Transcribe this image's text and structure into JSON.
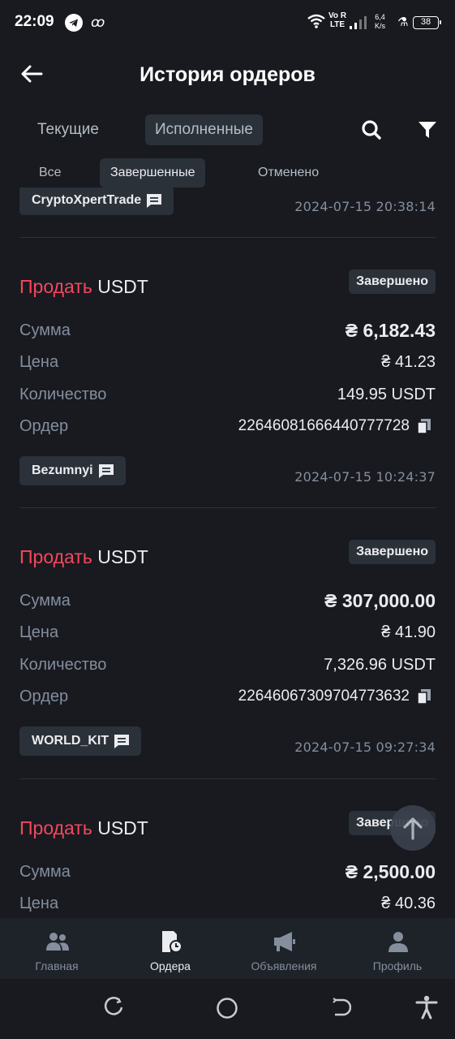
{
  "status_bar": {
    "time": "22:09",
    "volte_top": "Vo R",
    "volte_bottom": "LTE",
    "speed_top": "6,4",
    "speed_bottom": "K/s",
    "battery": "38",
    "misc_glyph": "ꝏ",
    "icons": [
      "telegram-icon",
      "wifi-icon",
      "signal-icon",
      "flask-icon",
      "battery-icon"
    ]
  },
  "header": {
    "title": "История ордеров"
  },
  "tabs": [
    {
      "label": "Текущие",
      "active": false
    },
    {
      "label": "Исполненные",
      "active": true
    }
  ],
  "subtabs": [
    {
      "label": "Все",
      "active": false
    },
    {
      "label": "Завершенные",
      "active": true
    },
    {
      "label": "Отменено",
      "active": false
    }
  ],
  "orders": [
    {
      "counterparty": "CryptoXpertTrade",
      "timestamp": "2024-07-15 20:38:14"
    },
    {
      "side": "Продать",
      "asset": "USDT",
      "status": "Завершено",
      "amount_label": "Сумма",
      "amount": "₴ 6,182.43",
      "price_label": "Цена",
      "price": "₴ 41.23",
      "qty_label": "Количество",
      "qty": "149.95 USDT",
      "order_label": "Ордер",
      "order_id": "22646081666440777728",
      "counterparty": "Bezumnyi",
      "timestamp": "2024-07-15 10:24:37"
    },
    {
      "side": "Продать",
      "asset": "USDT",
      "status": "Завершено",
      "amount_label": "Сумма",
      "amount": "₴ 307,000.00",
      "price_label": "Цена",
      "price": "₴ 41.90",
      "qty_label": "Количество",
      "qty": "7,326.96 USDT",
      "order_label": "Ордер",
      "order_id": "22646067309704773632",
      "counterparty": "WORLD_KIT",
      "timestamp": "2024-07-15 09:27:34"
    },
    {
      "side": "Продать",
      "asset": "USDT",
      "status": "Завершено",
      "amount_label": "Сумма",
      "amount": "₴ 2,500.00",
      "price_label": "Цена",
      "price": "₴ 40.36"
    }
  ],
  "bottom_nav": [
    {
      "label": "Главная",
      "icon": "people-icon",
      "active": false
    },
    {
      "label": "Ордера",
      "icon": "orders-clock-icon",
      "active": true
    },
    {
      "label": "Объявления",
      "icon": "megaphone-icon",
      "active": false
    },
    {
      "label": "Профиль",
      "icon": "profile-icon",
      "active": false
    }
  ],
  "colors": {
    "background": "#181a20",
    "sell": "#f6465d",
    "chip_bg": "#2b3139",
    "muted": "#848e9c"
  }
}
